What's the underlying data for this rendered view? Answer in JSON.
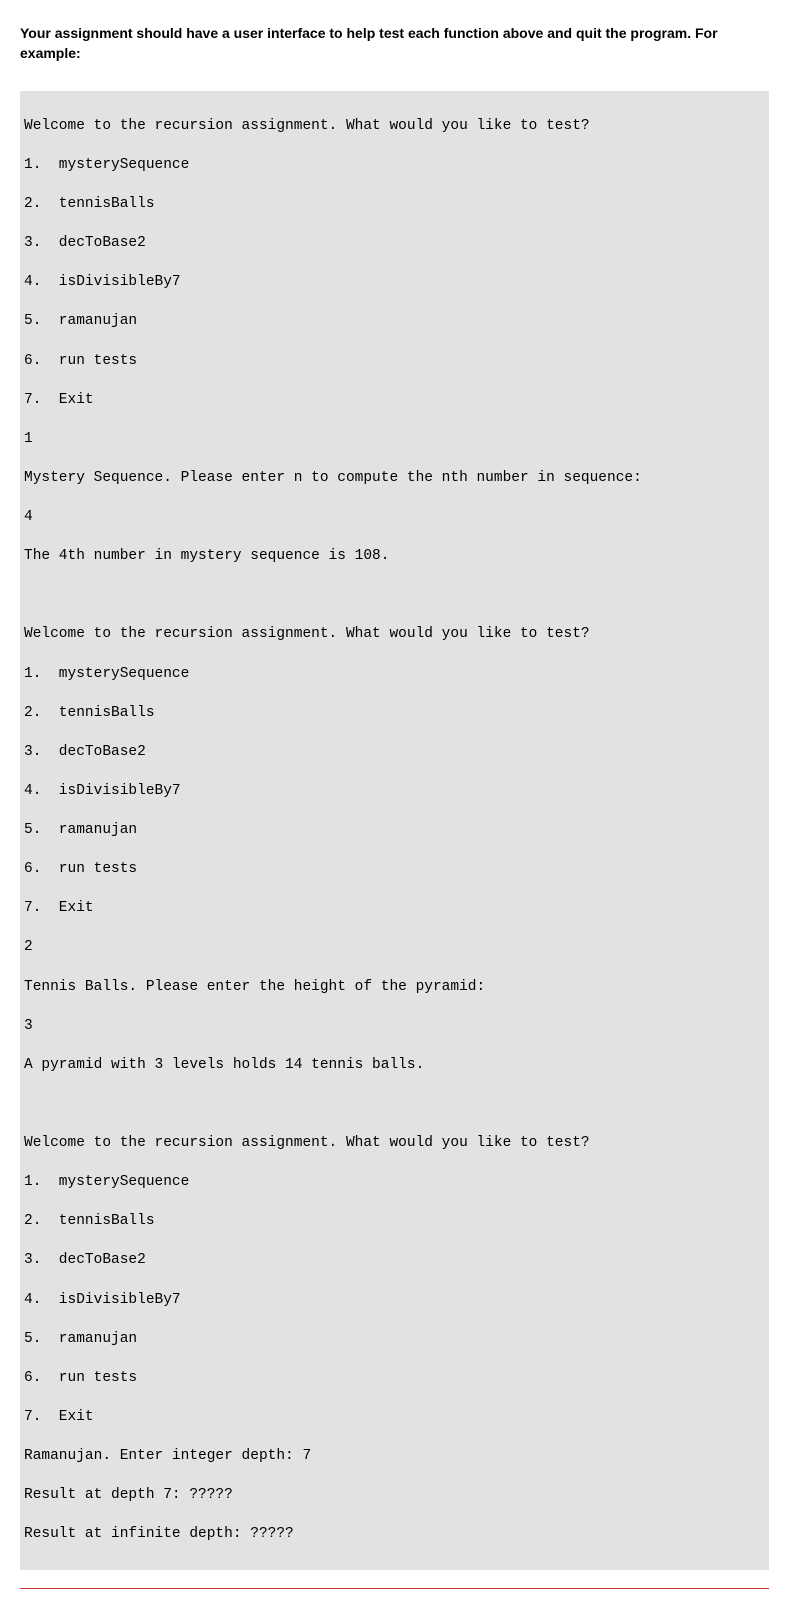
{
  "instruction": "Your assignment should have a user interface to help test each function above and quit the program. For example:",
  "menu": {
    "prompt": "Welcome to the recursion assignment. What would you like to test?",
    "items": [
      "1.  mysterySequence",
      "2.  tennisBalls",
      "3.  decToBase2",
      "4.  isDivisibleBy7",
      "5.  ramanujan",
      "6.  run tests",
      "7.  Exit"
    ]
  },
  "session1": {
    "input_choice": "1",
    "prompt_line": "Mystery Sequence. Please enter n to compute the nth number in sequence:",
    "input_n": "4",
    "result": "The 4th number in mystery sequence is 108."
  },
  "session2": {
    "input_choice": "2",
    "prompt_line": "Tennis Balls. Please enter the height of the pyramid:",
    "input_n": "3",
    "result": "A pyramid with 3 levels holds 14 tennis balls."
  },
  "session3": {
    "prompt_line": "Ramanujan. Enter integer depth: 7",
    "result1": "Result at depth 7: ?????",
    "result2": "Result at infinite depth: ?????"
  }
}
